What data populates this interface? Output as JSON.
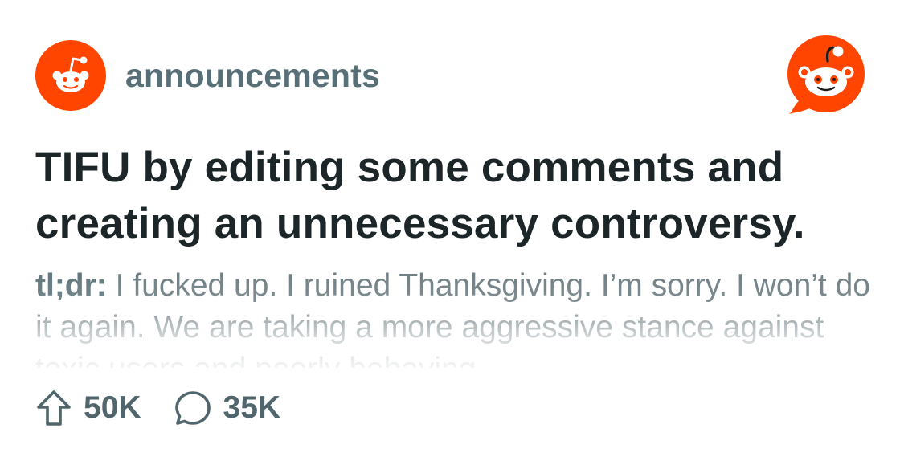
{
  "subreddit": {
    "name": "announcements",
    "avatar_icon": "reddit-snoo-icon"
  },
  "brand": {
    "logo_icon": "reddit-logo-icon",
    "color": "#ff4500"
  },
  "post": {
    "title": "TIFU by editing some comments and creating an unnecessary controversy.",
    "excerpt_lead": "tl;dr:",
    "excerpt_body": " I fucked up. I ruined Thanksgiving. I’m sorry. I won’t do it again. We are taking a more aggressive stance against toxic users and poorly behaving"
  },
  "stats": {
    "upvotes": "50K",
    "upvote_icon": "upvote-arrow-icon",
    "comments": "35K",
    "comment_icon": "comment-bubble-icon"
  }
}
